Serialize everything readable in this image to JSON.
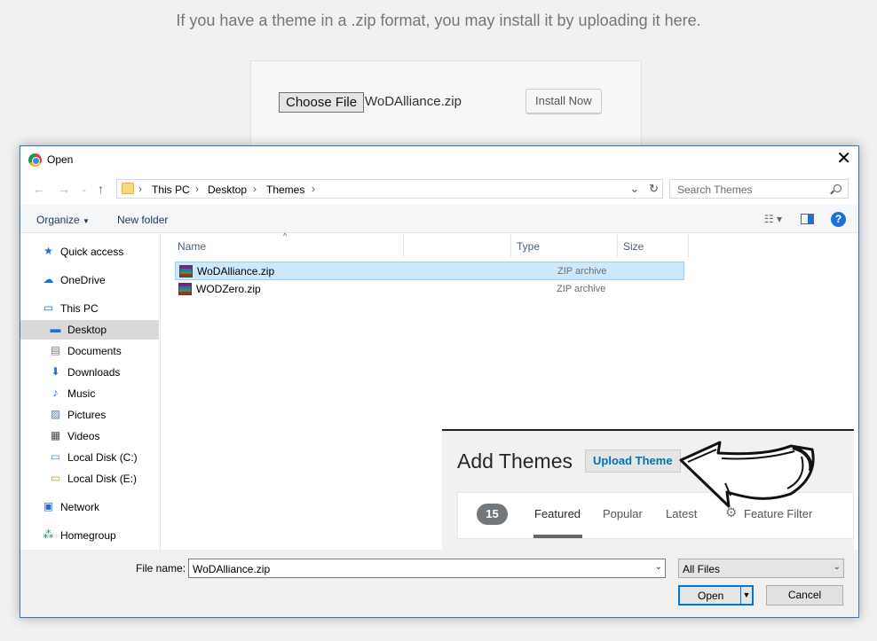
{
  "background": {
    "instruction": "If you have a theme in a .zip format, you may install it by uploading it here.",
    "choose_file_label": "Choose File",
    "chosen_file": "WoDAlliance.zip",
    "install_label": "Install Now"
  },
  "dialog": {
    "title": "Open",
    "close_glyph": "✕",
    "breadcrumbs": [
      "This PC",
      "Desktop",
      "Themes"
    ],
    "search_placeholder": "Search Themes",
    "toolbar": {
      "organize": "Organize",
      "new_folder": "New folder",
      "help": "?"
    },
    "sidebar": [
      {
        "label": "Quick access",
        "icon": "star-icon"
      },
      {
        "label": "OneDrive",
        "icon": "cloud-icon"
      },
      {
        "label": "This PC",
        "icon": "computer-icon"
      },
      {
        "label": "Desktop",
        "icon": "desktop-icon",
        "selected": true
      },
      {
        "label": "Documents",
        "icon": "document-icon"
      },
      {
        "label": "Downloads",
        "icon": "download-icon"
      },
      {
        "label": "Music",
        "icon": "music-icon"
      },
      {
        "label": "Pictures",
        "icon": "picture-icon"
      },
      {
        "label": "Videos",
        "icon": "video-icon"
      },
      {
        "label": "Local Disk (C:)",
        "icon": "drive-icon"
      },
      {
        "label": "Local Disk (E:)",
        "icon": "drive-icon"
      },
      {
        "label": "Network",
        "icon": "network-icon"
      },
      {
        "label": "Homegroup",
        "icon": "homegroup-icon"
      }
    ],
    "columns": {
      "name": "Name",
      "type": "Type",
      "size": "Size"
    },
    "files": [
      {
        "name": "WoDAlliance.zip",
        "type": "ZIP archive",
        "selected": true
      },
      {
        "name": "WODZero.zip",
        "type": "ZIP archive"
      }
    ],
    "file_name_label": "File name:",
    "file_name_value": "WoDAlliance.zip",
    "file_type_filter": "All Files",
    "open_label": "Open",
    "cancel_label": "Cancel"
  },
  "overlay": {
    "title": "Add Themes",
    "upload_button": "Upload Theme",
    "count": "15",
    "tabs": [
      "Featured",
      "Popular",
      "Latest"
    ],
    "feature_filter": "Feature Filter"
  },
  "colors": {
    "accent": "#0078d7",
    "wp_link": "#0073aa",
    "selection": "#cce8ff"
  }
}
